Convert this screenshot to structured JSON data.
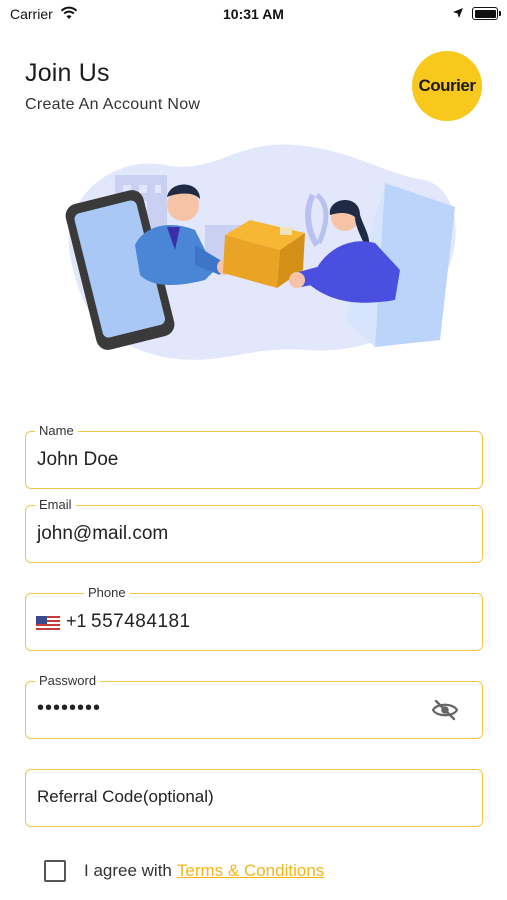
{
  "status_bar": {
    "carrier": "Carrier",
    "time": "10:31 AM"
  },
  "header": {
    "title": "Join Us",
    "subtitle": "Create An Account Now",
    "logo_text": "Courier"
  },
  "form": {
    "name": {
      "label": "Name",
      "value": "John Doe"
    },
    "email": {
      "label": "Email",
      "value": "john@mail.com"
    },
    "phone": {
      "label": "Phone",
      "country_code": "+1",
      "value": "557484181"
    },
    "password": {
      "label": "Password",
      "value": "••••••••"
    },
    "referral": {
      "placeholder": "Referral Code(optional)"
    }
  },
  "agreement": {
    "text": "I agree with",
    "link": "Terms & Conditions",
    "checked": false
  },
  "colors": {
    "accent": "#f5c546",
    "logo_bg": "#f8c91c",
    "link": "#f3b619"
  }
}
